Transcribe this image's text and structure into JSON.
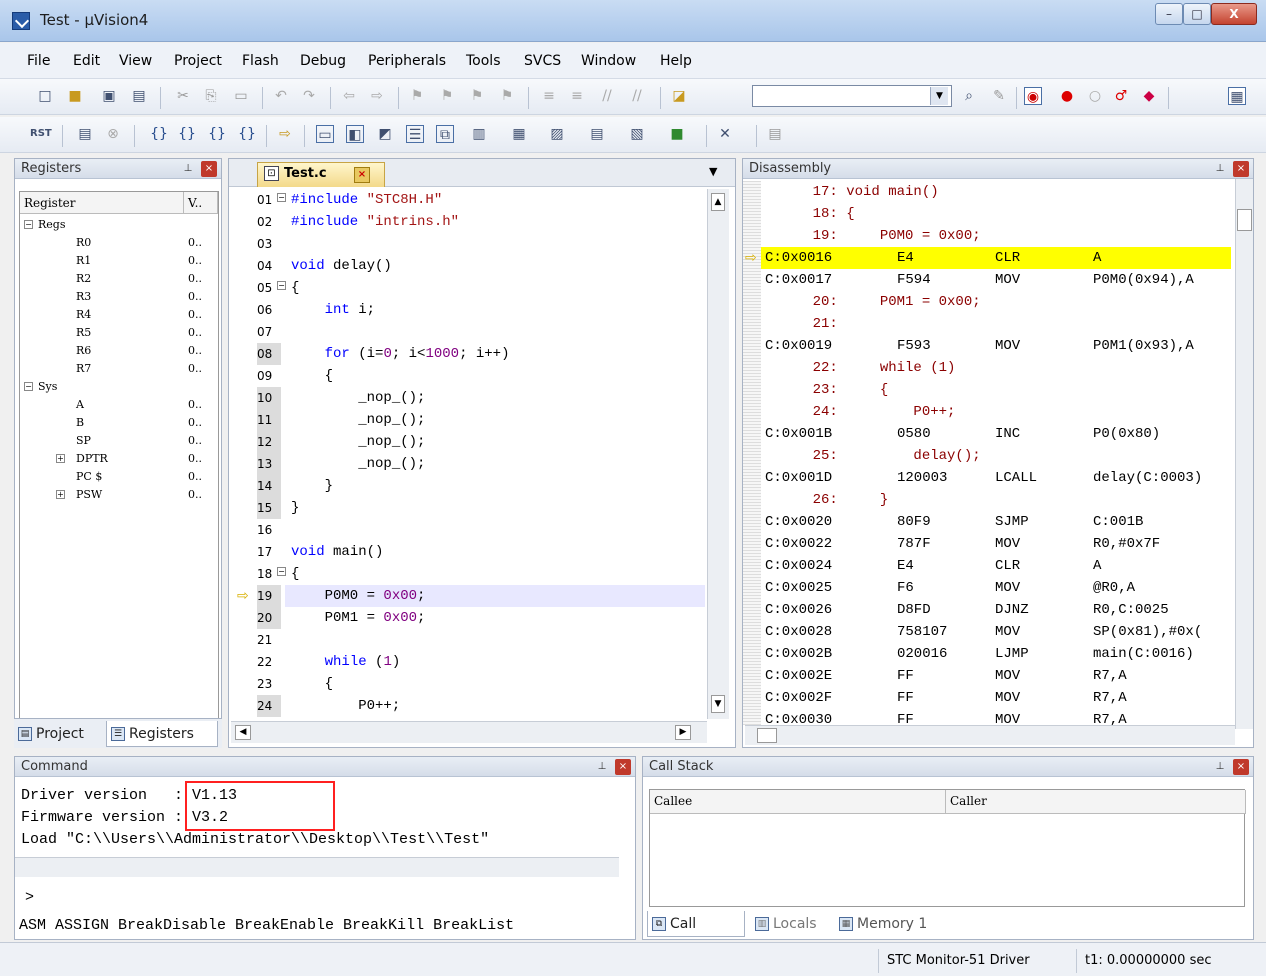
{
  "window": {
    "title": "Test - µVision4",
    "minimize": "–",
    "maximize": "□",
    "close": "X"
  },
  "menu": [
    "File",
    "Edit",
    "View",
    "Project",
    "Flash",
    "Debug",
    "Peripherals",
    "Tools",
    "SVCS",
    "Window",
    "Help"
  ],
  "registers_panel": {
    "title": "Registers",
    "col_register": "Register",
    "col_value": "V..",
    "rows": [
      {
        "name": "Regs",
        "value": "",
        "level": 0,
        "expander": "−"
      },
      {
        "name": "R0",
        "value": "0..",
        "level": 1,
        "expander": ""
      },
      {
        "name": "R1",
        "value": "0..",
        "level": 1,
        "expander": ""
      },
      {
        "name": "R2",
        "value": "0..",
        "level": 1,
        "expander": ""
      },
      {
        "name": "R3",
        "value": "0..",
        "level": 1,
        "expander": ""
      },
      {
        "name": "R4",
        "value": "0..",
        "level": 1,
        "expander": ""
      },
      {
        "name": "R5",
        "value": "0..",
        "level": 1,
        "expander": ""
      },
      {
        "name": "R6",
        "value": "0..",
        "level": 1,
        "expander": ""
      },
      {
        "name": "R7",
        "value": "0..",
        "level": 1,
        "expander": ""
      },
      {
        "name": "Sys",
        "value": "",
        "level": 0,
        "expander": "−"
      },
      {
        "name": "A",
        "value": "0..",
        "level": 1,
        "expander": ""
      },
      {
        "name": "B",
        "value": "0..",
        "level": 1,
        "expander": ""
      },
      {
        "name": "SP",
        "value": "0..",
        "level": 1,
        "expander": ""
      },
      {
        "name": "DPTR",
        "value": "0..",
        "level": 1,
        "expander": "+"
      },
      {
        "name": "PC $",
        "value": "0..",
        "level": 1,
        "expander": ""
      },
      {
        "name": "PSW",
        "value": "0..",
        "level": 1,
        "expander": "+"
      }
    ],
    "tab_project": "Project",
    "tab_registers": "Registers"
  },
  "editor": {
    "tab_label": "Test.c",
    "lines": [
      {
        "num": "01",
        "code": "#include \"STC8H.H\"",
        "gray": false
      },
      {
        "num": "02",
        "code": "#include \"intrins.h\"",
        "gray": false
      },
      {
        "num": "03",
        "code": "",
        "gray": false
      },
      {
        "num": "04",
        "code": "void delay()",
        "gray": false
      },
      {
        "num": "05",
        "code": "{",
        "gray": false
      },
      {
        "num": "06",
        "code": "    int i;",
        "gray": false
      },
      {
        "num": "07",
        "code": "",
        "gray": false
      },
      {
        "num": "08",
        "code": "    for (i=0; i<1000; i++)",
        "gray": true
      },
      {
        "num": "09",
        "code": "    {",
        "gray": false
      },
      {
        "num": "10",
        "code": "        _nop_();",
        "gray": true
      },
      {
        "num": "11",
        "code": "        _nop_();",
        "gray": true
      },
      {
        "num": "12",
        "code": "        _nop_();",
        "gray": true
      },
      {
        "num": "13",
        "code": "        _nop_();",
        "gray": true
      },
      {
        "num": "14",
        "code": "    }",
        "gray": true
      },
      {
        "num": "15",
        "code": "}",
        "gray": true
      },
      {
        "num": "16",
        "code": "",
        "gray": false
      },
      {
        "num": "17",
        "code": "void main()",
        "gray": false
      },
      {
        "num": "18",
        "code": "{",
        "gray": false
      },
      {
        "num": "19",
        "code": "    P0M0 = 0x00;",
        "gray": true
      },
      {
        "num": "20",
        "code": "    P0M1 = 0x00;",
        "gray": true
      },
      {
        "num": "21",
        "code": "",
        "gray": false
      },
      {
        "num": "22",
        "code": "    while (1)",
        "gray": false
      },
      {
        "num": "23",
        "code": "    {",
        "gray": false
      },
      {
        "num": "24",
        "code": "        P0++;",
        "gray": true
      }
    ]
  },
  "disassembly": {
    "title": "Disassembly",
    "lines": [
      {
        "addr": "",
        "op": "",
        "mn": "",
        "arg": "",
        "src": "    17: void main()"
      },
      {
        "addr": "",
        "op": "",
        "mn": "",
        "arg": "",
        "src": "    18: {"
      },
      {
        "addr": "",
        "op": "",
        "mn": "",
        "arg": "",
        "src": "    19:     P0M0 = 0x00;"
      },
      {
        "addr": "C:0x0016",
        "op": "E4",
        "mn": "CLR",
        "arg": "A",
        "src": ""
      },
      {
        "addr": "C:0x0017",
        "op": "F594",
        "mn": "MOV",
        "arg": "P0M0(0x94),A",
        "src": ""
      },
      {
        "addr": "",
        "op": "",
        "mn": "",
        "arg": "",
        "src": "    20:     P0M1 = 0x00;"
      },
      {
        "addr": "",
        "op": "",
        "mn": "",
        "arg": "",
        "src": "    21: "
      },
      {
        "addr": "C:0x0019",
        "op": "F593",
        "mn": "MOV",
        "arg": "P0M1(0x93),A",
        "src": ""
      },
      {
        "addr": "",
        "op": "",
        "mn": "",
        "arg": "",
        "src": "    22:     while (1)"
      },
      {
        "addr": "",
        "op": "",
        "mn": "",
        "arg": "",
        "src": "    23:     {"
      },
      {
        "addr": "",
        "op": "",
        "mn": "",
        "arg": "",
        "src": "    24:         P0++;"
      },
      {
        "addr": "C:0x001B",
        "op": "0580",
        "mn": "INC",
        "arg": "P0(0x80)",
        "src": ""
      },
      {
        "addr": "",
        "op": "",
        "mn": "",
        "arg": "",
        "src": "    25:         delay();"
      },
      {
        "addr": "C:0x001D",
        "op": "120003",
        "mn": "LCALL",
        "arg": "delay(C:0003)",
        "src": ""
      },
      {
        "addr": "",
        "op": "",
        "mn": "",
        "arg": "",
        "src": "    26:     }"
      },
      {
        "addr": "C:0x0020",
        "op": "80F9",
        "mn": "SJMP",
        "arg": "C:001B",
        "src": ""
      },
      {
        "addr": "C:0x0022",
        "op": "787F",
        "mn": "MOV",
        "arg": "R0,#0x7F",
        "src": ""
      },
      {
        "addr": "C:0x0024",
        "op": "E4",
        "mn": "CLR",
        "arg": "A",
        "src": ""
      },
      {
        "addr": "C:0x0025",
        "op": "F6",
        "mn": "MOV",
        "arg": "@R0,A",
        "src": ""
      },
      {
        "addr": "C:0x0026",
        "op": "D8FD",
        "mn": "DJNZ",
        "arg": "R0,C:0025",
        "src": ""
      },
      {
        "addr": "C:0x0028",
        "op": "758107",
        "mn": "MOV",
        "arg": "SP(0x81),#0x(",
        "src": ""
      },
      {
        "addr": "C:0x002B",
        "op": "020016",
        "mn": "LJMP",
        "arg": "main(C:0016)",
        "src": ""
      },
      {
        "addr": "C:0x002E",
        "op": "FF",
        "mn": "MOV",
        "arg": "R7,A",
        "src": ""
      },
      {
        "addr": "C:0x002F",
        "op": "FF",
        "mn": "MOV",
        "arg": "R7,A",
        "src": ""
      },
      {
        "addr": "C:0x0030",
        "op": "FF",
        "mn": "MOV",
        "arg": "R7,A",
        "src": ""
      }
    ]
  },
  "command": {
    "title": "Command",
    "lines": [
      "Driver version   : V1.13",
      "Firmware version : V3.2",
      "Load \"C:\\\\Users\\\\Administrator\\\\Desktop\\\\Test\\\\Test\""
    ],
    "prompt": ">",
    "hint": "ASM ASSIGN BreakDisable BreakEnable BreakKill BreakList"
  },
  "callstack": {
    "title": "Call Stack",
    "col_callee": "Callee",
    "col_caller": "Caller",
    "tabs": [
      "Call Stack",
      "Locals",
      "Memory 1"
    ]
  },
  "status": {
    "driver": "STC Monitor-51 Driver",
    "time": "t1: 0.00000000 sec"
  },
  "colors": {
    "highlight_exec": "#ffff00",
    "current_line": "#e8e8ff",
    "keyword": "#0000ff",
    "number": "#800080",
    "string": "#a31515",
    "annotation_box": "#ff0000"
  }
}
